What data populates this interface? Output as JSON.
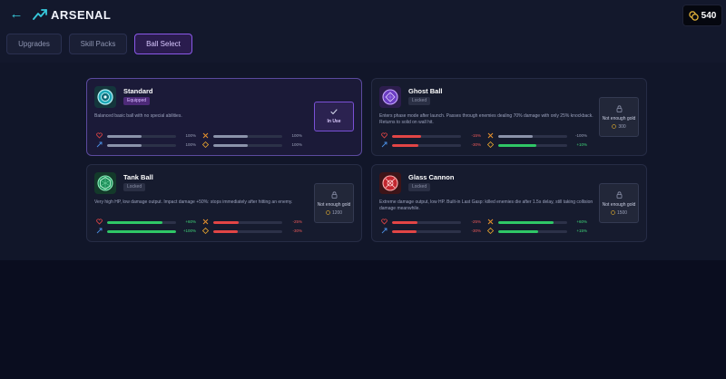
{
  "header": {
    "title": "ARSENAL",
    "gold": "540"
  },
  "tabs": [
    {
      "label": "Upgrades",
      "active": false
    },
    {
      "label": "Skill Packs",
      "active": false
    },
    {
      "label": "Ball Select",
      "active": true
    }
  ],
  "colors": {
    "accent_purple": "#8a58e8",
    "accent_cyan": "#37c9dc",
    "stat_good": "#2fc766",
    "stat_bad": "#e24545",
    "stat_neutral": "#8b93aa"
  },
  "cards": [
    {
      "name": "Standard",
      "badge": "Equipped",
      "status": "equipped",
      "description": "Balanced basic ball with no special abilities.",
      "stats": [
        {
          "icon": "heart-icon",
          "value": "100%",
          "level": 0.5,
          "tone": "neutral"
        },
        {
          "icon": "damage-icon",
          "value": "100%",
          "level": 0.5,
          "tone": "neutral"
        },
        {
          "icon": "speed-icon",
          "value": "100%",
          "level": 0.5,
          "tone": "neutral"
        },
        {
          "icon": "size-icon",
          "value": "100%",
          "level": 0.5,
          "tone": "neutral"
        }
      ],
      "action": {
        "label": "In Use"
      }
    },
    {
      "name": "Ghost Ball",
      "badge": "Locked",
      "status": "locked",
      "description": "Enters phase mode after launch. Passes through enemies dealing 70% damage with only 25% knockback. Returns to solid on wall hit.",
      "stats": [
        {
          "icon": "heart-icon",
          "value": "-15%",
          "level": 0.42,
          "tone": "bad"
        },
        {
          "icon": "damage-icon",
          "value": "-100%",
          "level": 0.5,
          "tone": "neutral"
        },
        {
          "icon": "speed-icon",
          "value": "-30%",
          "level": 0.38,
          "tone": "bad"
        },
        {
          "icon": "size-icon",
          "value": "+10%",
          "level": 0.55,
          "tone": "good"
        }
      ],
      "action": {
        "label": "Not enough gold",
        "cost": "300"
      }
    },
    {
      "name": "Tank Ball",
      "badge": "Locked",
      "status": "locked",
      "description": "Very high HP, low damage output. Impact damage +50%: stops immediately after hitting an enemy.",
      "stats": [
        {
          "icon": "heart-icon",
          "value": "+60%",
          "level": 0.8,
          "tone": "good"
        },
        {
          "icon": "damage-icon",
          "value": "-25%",
          "level": 0.37,
          "tone": "bad"
        },
        {
          "icon": "speed-icon",
          "value": "+100%",
          "level": 1.0,
          "tone": "good"
        },
        {
          "icon": "size-icon",
          "value": "-30%",
          "level": 0.35,
          "tone": "bad"
        }
      ],
      "action": {
        "label": "Not enough gold",
        "cost": "1200"
      }
    },
    {
      "name": "Glass Cannon",
      "badge": "Locked",
      "status": "locked",
      "description": "Extreme damage output, low HP. Built-in Last Gasp: killed enemies die after 1.5s delay, still taking collision damage meanwhile.",
      "stats": [
        {
          "icon": "heart-icon",
          "value": "-25%",
          "level": 0.37,
          "tone": "bad"
        },
        {
          "icon": "damage-icon",
          "value": "+60%",
          "level": 0.8,
          "tone": "good"
        },
        {
          "icon": "speed-icon",
          "value": "-30%",
          "level": 0.35,
          "tone": "bad"
        },
        {
          "icon": "size-icon",
          "value": "+15%",
          "level": 0.58,
          "tone": "good"
        }
      ],
      "action": {
        "label": "Not enough gold",
        "cost": "1500"
      }
    }
  ]
}
